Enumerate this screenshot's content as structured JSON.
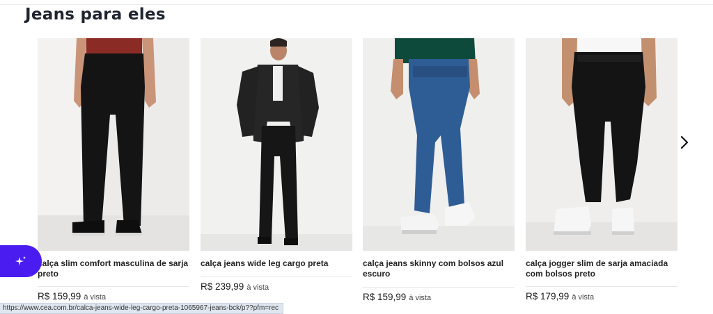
{
  "section": {
    "title": "Jeans para eles"
  },
  "products": [
    {
      "name": "calça slim comfort masculina de sarja preto",
      "price": "R$ 159,99",
      "price_suffix": "à vista"
    },
    {
      "name": "calça jeans wide leg cargo preta",
      "price": "R$ 239,99",
      "price_suffix": "à vista"
    },
    {
      "name": "calça jeans skinny com bolsos azul escuro",
      "price": "R$ 159,99",
      "price_suffix": "à vista"
    },
    {
      "name": "calça jogger slim de sarja amaciada com bolsos preto",
      "price": "R$ 179,99",
      "price_suffix": "à vista"
    }
  ],
  "carousel": {
    "next_icon": "chevron-right-icon"
  },
  "assistant": {
    "icon": "sparkle-icon",
    "color": "#4a1cf0"
  },
  "status_bar": {
    "url": "https://www.cea.com.br/calca-jeans-wide-leg-cargo-preta-1065967-jeans-bck/p??pfm=rec"
  }
}
